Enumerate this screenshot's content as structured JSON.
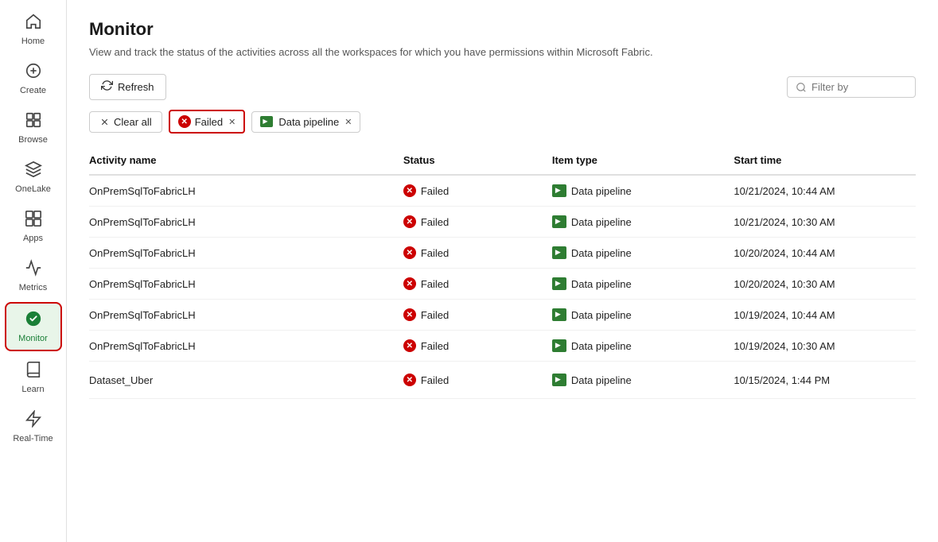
{
  "sidebar": {
    "items": [
      {
        "id": "home",
        "label": "Home",
        "icon": "⌂",
        "active": false
      },
      {
        "id": "create",
        "label": "Create",
        "icon": "+",
        "active": false
      },
      {
        "id": "browse",
        "label": "Browse",
        "icon": "⊞",
        "active": false
      },
      {
        "id": "onelake",
        "label": "OneLake",
        "icon": "◈",
        "active": false
      },
      {
        "id": "apps",
        "label": "Apps",
        "icon": "⊠",
        "active": false
      },
      {
        "id": "metrics",
        "label": "Metrics",
        "icon": "⏣",
        "active": false
      },
      {
        "id": "monitor",
        "label": "Monitor",
        "icon": "●",
        "active": true
      },
      {
        "id": "learn",
        "label": "Learn",
        "icon": "⊟",
        "active": false
      },
      {
        "id": "realtime",
        "label": "Real-Time",
        "icon": "⚡",
        "active": false
      }
    ]
  },
  "page": {
    "title": "Monitor",
    "subtitle": "View and track the status of the activities across all the workspaces for which you have permissions within Microsoft Fabric."
  },
  "toolbar": {
    "refresh_label": "Refresh",
    "filter_placeholder": "Filter by"
  },
  "filters": {
    "clear_all_label": "Clear all",
    "chips": [
      {
        "id": "failed",
        "label": "Failed",
        "active": true
      },
      {
        "id": "data-pipeline",
        "label": "Data pipeline",
        "active": false
      }
    ]
  },
  "table": {
    "columns": [
      {
        "id": "activity_name",
        "label": "Activity name"
      },
      {
        "id": "status",
        "label": "Status"
      },
      {
        "id": "item_type",
        "label": "Item type"
      },
      {
        "id": "start_time",
        "label": "Start time"
      }
    ],
    "rows": [
      {
        "activity_name": "OnPremSqlToFabricLH",
        "status": "Failed",
        "item_type": "Data pipeline",
        "start_time": "10/21/2024, 10:44 AM",
        "has_actions": false
      },
      {
        "activity_name": "OnPremSqlToFabricLH",
        "status": "Failed",
        "item_type": "Data pipeline",
        "start_time": "10/21/2024, 10:30 AM",
        "has_actions": false
      },
      {
        "activity_name": "OnPremSqlToFabricLH",
        "status": "Failed",
        "item_type": "Data pipeline",
        "start_time": "10/20/2024, 10:44 AM",
        "has_actions": false
      },
      {
        "activity_name": "OnPremSqlToFabricLH",
        "status": "Failed",
        "item_type": "Data pipeline",
        "start_time": "10/20/2024, 10:30 AM",
        "has_actions": false
      },
      {
        "activity_name": "OnPremSqlToFabricLH",
        "status": "Failed",
        "item_type": "Data pipeline",
        "start_time": "10/19/2024, 10:44 AM",
        "has_actions": false
      },
      {
        "activity_name": "OnPremSqlToFabricLH",
        "status": "Failed",
        "item_type": "Data pipeline",
        "start_time": "10/19/2024, 10:30 AM",
        "has_actions": false
      },
      {
        "activity_name": "Dataset_Uber",
        "status": "Failed",
        "item_type": "Data pipeline",
        "start_time": "10/15/2024, 1:44 PM",
        "has_actions": true
      }
    ]
  }
}
